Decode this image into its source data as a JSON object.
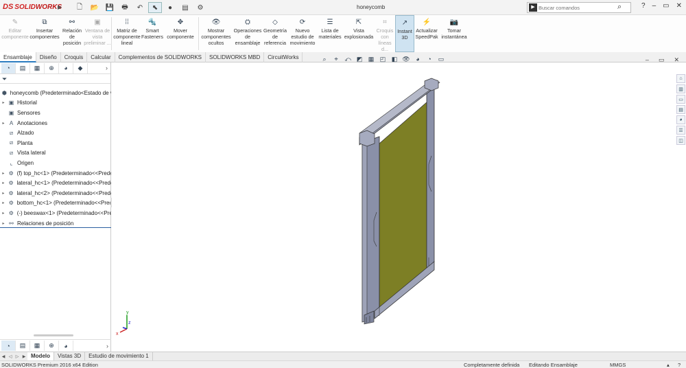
{
  "app": {
    "name_prefix": "DS",
    "name_solid": "SOLID",
    "name_works": "WORKS",
    "document_title": "honeycomb"
  },
  "search": {
    "placeholder": "Buscar comandos"
  },
  "ribbon": [
    {
      "label": "Editar componente",
      "disabled": true
    },
    {
      "label": "Insertar componentes",
      "disabled": false
    },
    {
      "label": "Relación de posición",
      "disabled": false
    },
    {
      "label": "Ventana de vista preliminar ...",
      "disabled": true
    },
    {
      "label": "Matriz de componente lineal",
      "disabled": false
    },
    {
      "label": "Smart Fasteners",
      "disabled": false
    },
    {
      "label": "Mover componente",
      "disabled": false
    },
    {
      "label": "Mostrar componentes ocultos",
      "disabled": false
    },
    {
      "label": "Operaciones de ensamblaje",
      "disabled": false
    },
    {
      "label": "Geometría de referencia",
      "disabled": false
    },
    {
      "label": "Nuevo estudio de movimiento",
      "disabled": false
    },
    {
      "label": "Lista de materiales",
      "disabled": false
    },
    {
      "label": "Vista explosionada",
      "disabled": false
    },
    {
      "label": "Croquis con líneas d...",
      "disabled": true
    },
    {
      "label": "Instant 3D",
      "disabled": false,
      "active": true
    },
    {
      "label": "Actualizar SpeedPak",
      "disabled": false
    },
    {
      "label": "Tomar instantánea",
      "disabled": false
    }
  ],
  "command_tabs": [
    "Ensamblaje",
    "Diseño",
    "Croquis",
    "Calcular",
    "Complementos de SOLIDWORKS",
    "SOLIDWORKS MBD",
    "CircuitWorks"
  ],
  "tree": {
    "root": "honeycomb  (Predeterminado<Estado de v",
    "items": [
      {
        "label": "Historial",
        "icon": "history-icon",
        "expandable": true
      },
      {
        "label": "Sensores",
        "icon": "sensor-icon",
        "expandable": false
      },
      {
        "label": "Anotaciones",
        "icon": "annotation-icon",
        "expandable": true
      },
      {
        "label": "Alzado",
        "icon": "plane-icon",
        "expandable": false
      },
      {
        "label": "Planta",
        "icon": "plane-icon",
        "expandable": false
      },
      {
        "label": "Vista lateral",
        "icon": "plane-icon",
        "expandable": false
      },
      {
        "label": "Origen",
        "icon": "origin-icon",
        "expandable": false
      },
      {
        "label": "(f) top_hc<1> (Predeterminado<<Prede",
        "icon": "part-icon",
        "expandable": true
      },
      {
        "label": "lateral_hc<1> (Predeterminado<<Prede",
        "icon": "part-icon",
        "expandable": true
      },
      {
        "label": "lateral_hc<2> (Predeterminado<<Prede",
        "icon": "part-icon",
        "expandable": true
      },
      {
        "label": "bottom_hc<1> (Predeterminado<<Pred",
        "icon": "part-icon",
        "expandable": true
      },
      {
        "label": "(-) beeswax<1> (Predeterminado<<Pre",
        "icon": "part-icon",
        "expandable": true
      },
      {
        "label": "Relaciones de posición",
        "icon": "mate-icon",
        "expandable": true
      }
    ]
  },
  "model_tabs": [
    "Modelo",
    "Vistas 3D",
    "Estudio de movimiento 1"
  ],
  "status": {
    "edition": "SOLIDWORKS Premium 2016 x64 Edition",
    "definition": "Completamente definida",
    "mode": "Editando Ensamblaje",
    "units": "MMGS"
  },
  "triad": {
    "x": "x",
    "y": "y",
    "z": "z"
  },
  "colors": {
    "frame": "#8a90a8",
    "foundation": "#7d7f25",
    "accent": "#2a7bc0"
  }
}
